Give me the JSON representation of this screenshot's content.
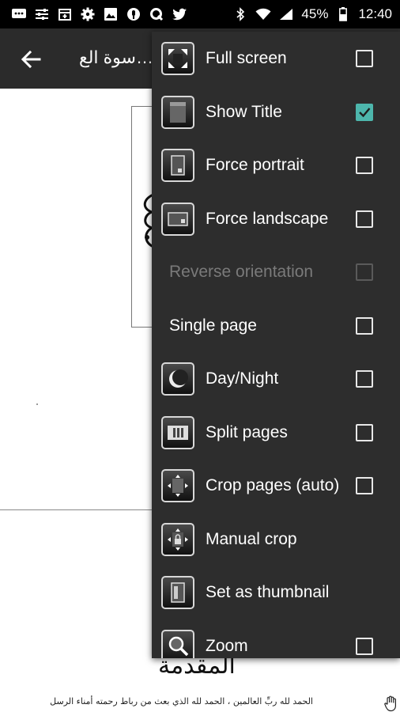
{
  "status_bar": {
    "battery": "45%",
    "time": "12:40",
    "left_icons": [
      "message-icon",
      "sliders-icon",
      "calendar-icon",
      "settings-icon",
      "image-icon",
      "podcast-icon",
      "q-icon",
      "twitter-icon"
    ],
    "right_icons": [
      "bluetooth-icon",
      "wifi-icon",
      "signal-icon",
      "battery-icon"
    ]
  },
  "toolbar": {
    "back_icon": "arrow-left-icon",
    "title": "…سوة الع"
  },
  "document": {
    "heading": "المقدمة",
    "footer_line": "الحمد لله ربِّ العالمين ، الحمد لله الذي بعث من رباط رحمته أمناء الرسل"
  },
  "menu": {
    "items": [
      {
        "label": "Full screen",
        "icon": "fullscreen-icon",
        "checkbox": true,
        "checked": false,
        "disabled": false
      },
      {
        "label": "Show Title",
        "icon": "title-icon",
        "checkbox": true,
        "checked": true,
        "disabled": false
      },
      {
        "label": "Force portrait",
        "icon": "portrait-icon",
        "checkbox": true,
        "checked": false,
        "disabled": false
      },
      {
        "label": "Force landscape",
        "icon": "landscape-icon",
        "checkbox": true,
        "checked": false,
        "disabled": false
      },
      {
        "label": "Reverse orientation",
        "icon": null,
        "checkbox": true,
        "checked": false,
        "disabled": true
      },
      {
        "label": "Single page",
        "icon": null,
        "checkbox": true,
        "checked": false,
        "disabled": false
      },
      {
        "label": "Day/Night",
        "icon": "moon-icon",
        "checkbox": true,
        "checked": false,
        "disabled": false
      },
      {
        "label": "Split pages",
        "icon": "split-pages-icon",
        "checkbox": true,
        "checked": false,
        "disabled": false
      },
      {
        "label": "Crop pages (auto)",
        "icon": "crop-auto-icon",
        "checkbox": true,
        "checked": false,
        "disabled": false
      },
      {
        "label": "Manual crop",
        "icon": "manual-crop-icon",
        "checkbox": false,
        "checked": false,
        "disabled": false
      },
      {
        "label": "Set as thumbnail",
        "icon": "thumbnail-icon",
        "checkbox": false,
        "checked": false,
        "disabled": false
      },
      {
        "label": "Zoom",
        "icon": "zoom-icon",
        "checkbox": true,
        "checked": false,
        "disabled": false
      }
    ]
  },
  "colors": {
    "status_bar": "#000000",
    "toolbar": "#2b2b2b",
    "menu_bg": "#2d2d2d",
    "check_accent": "#4db6ac",
    "disabled_text": "#7a7a7a"
  }
}
